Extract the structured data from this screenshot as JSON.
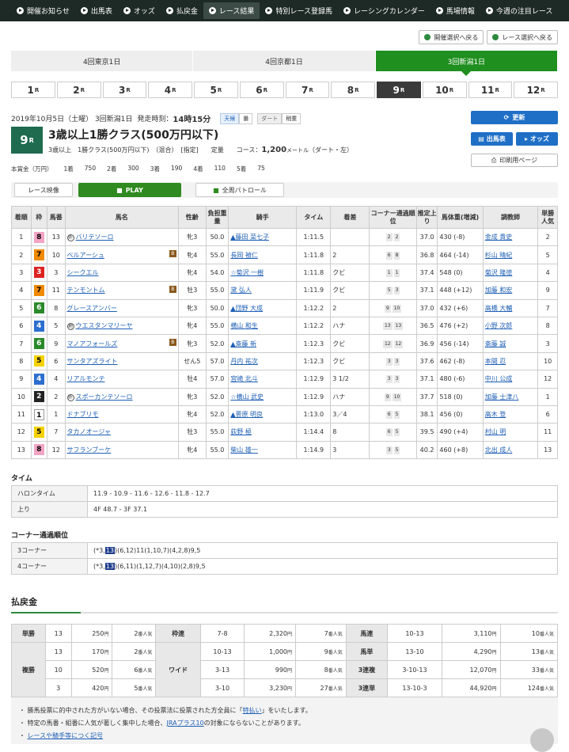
{
  "nav": [
    "開催お知らせ",
    "出馬表",
    "オッズ",
    "払戻金",
    "レース結果",
    "特別レース登録馬",
    "レーシングカレンダー",
    "馬場情報",
    "今週の注目レース"
  ],
  "nav_active": 4,
  "back_buttons": [
    "開催選択へ戻る",
    "レース選択へ戻る"
  ],
  "kaisai_tabs": [
    "4回東京1日",
    "4回京都1日",
    "3回新潟1日"
  ],
  "kaisai_active": 2,
  "race_numbers": [
    "1",
    "2",
    "3",
    "4",
    "5",
    "6",
    "7",
    "8",
    "9",
    "10",
    "11",
    "12"
  ],
  "race_suffix": "R",
  "race_active": 8,
  "info": {
    "date": "2019年10月5日（土曜） 3回新潟1日",
    "start_label": "発走時刻：",
    "start_time": "14時15分",
    "weather_label": "天候",
    "weather": "曇",
    "track_label": "ダート",
    "track_cond": "稍重",
    "race_no": "9",
    "race_r": "R",
    "title": "3歳以上1勝クラス(500万円以下)",
    "sub1": "3歳以上　1勝クラス(500万円以下)　（混合）　[指定]　　定量",
    "course_label": "コース：",
    "distance": "1,200",
    "dist_unit": "メートル",
    "surface": "（ダート・左）"
  },
  "buttons": {
    "refresh": "更新",
    "shutuba": "出馬表",
    "odds": "オッズ",
    "print": "印刷用ページ",
    "video": "レース映像",
    "play": "PLAY",
    "patrol": "全周パトロール"
  },
  "prize": [
    "本賞金（万円）",
    "1着",
    "750",
    "2着",
    "300",
    "3着",
    "190",
    "4着",
    "110",
    "5着",
    "75"
  ],
  "table_headers": [
    "着順",
    "枠",
    "馬番",
    "馬名",
    "性齢",
    "負担重量",
    "騎手",
    "タイム",
    "着差",
    "コーナー通過順位",
    "推定上り",
    "馬体重(増減)",
    "調教師",
    "単勝人気"
  ],
  "results": [
    {
      "pos": "1",
      "waku": "8",
      "num": "13",
      "mark": "外",
      "name": "バリテソーロ",
      "b": "",
      "sex": "牝3",
      "wt": "50.0",
      "jockey": "▲藤田 菜七子",
      "time": "1:11.5",
      "margin": "",
      "c1": "2",
      "c2": "2",
      "agari": "37.0",
      "bw": "430 (-8)",
      "trainer": "金成 貴史",
      "pop": "2"
    },
    {
      "pos": "2",
      "waku": "7",
      "num": "10",
      "mark": "",
      "name": "ベルアーシュ",
      "b": "B",
      "sex": "牝4",
      "wt": "55.0",
      "jockey": "長岡 禎仁",
      "time": "1:11.8",
      "margin": "2",
      "c1": "6",
      "c2": "8",
      "agari": "36.8",
      "bw": "464 (-14)",
      "trainer": "杉山 晴紀",
      "pop": "5"
    },
    {
      "pos": "3",
      "waku": "3",
      "num": "3",
      "mark": "",
      "name": "シークエル",
      "b": "",
      "sex": "牝4",
      "wt": "54.0",
      "jockey": "☆菊沢 一樹",
      "time": "1:11.8",
      "margin": "クビ",
      "c1": "1",
      "c2": "1",
      "agari": "37.4",
      "bw": "548 (0)",
      "trainer": "菊沢 隆徳",
      "pop": "4"
    },
    {
      "pos": "4",
      "waku": "7",
      "num": "11",
      "mark": "",
      "name": "テンモントム",
      "b": "B",
      "sex": "牡3",
      "wt": "55.0",
      "jockey": "黛 弘人",
      "time": "1:11.9",
      "margin": "クビ",
      "c1": "5",
      "c2": "3",
      "agari": "37.1",
      "bw": "448 (+12)",
      "trainer": "加藤 和宏",
      "pop": "9"
    },
    {
      "pos": "5",
      "waku": "6",
      "num": "8",
      "mark": "",
      "name": "グレースアンバー",
      "b": "",
      "sex": "牝3",
      "wt": "50.0",
      "jockey": "▲団野 大成",
      "time": "1:12.2",
      "margin": "2",
      "c1": "9",
      "c2": "10",
      "agari": "37.0",
      "bw": "432 (+6)",
      "trainer": "高橋 大輔",
      "pop": "7"
    },
    {
      "pos": "6",
      "waku": "4",
      "num": "5",
      "mark": "地",
      "name": "ウエスタンマリーヤ",
      "b": "",
      "sex": "牝4",
      "wt": "55.0",
      "jockey": "横山 和生",
      "time": "1:12.2",
      "margin": "ハナ",
      "c1": "13",
      "c2": "13",
      "agari": "36.5",
      "bw": "476 (+2)",
      "trainer": "小野 次郎",
      "pop": "8"
    },
    {
      "pos": "7",
      "waku": "6",
      "num": "9",
      "mark": "",
      "name": "マノアフォールズ",
      "b": "B",
      "sex": "牝3",
      "wt": "52.0",
      "jockey": "▲斎藤 新",
      "time": "1:12.3",
      "margin": "クビ",
      "c1": "12",
      "c2": "12",
      "agari": "36.9",
      "bw": "456 (-14)",
      "trainer": "斎藤 誠",
      "pop": "3"
    },
    {
      "pos": "8",
      "waku": "5",
      "num": "6",
      "mark": "",
      "name": "サンタアズライト",
      "b": "",
      "sex": "せん5",
      "wt": "57.0",
      "jockey": "丹内 祐次",
      "time": "1:12.3",
      "margin": "クビ",
      "c1": "3",
      "c2": "3",
      "agari": "37.6",
      "bw": "462 (-8)",
      "trainer": "本間 忍",
      "pop": "10"
    },
    {
      "pos": "9",
      "waku": "4",
      "num": "4",
      "mark": "",
      "name": "リアルモンテ",
      "b": "",
      "sex": "牡4",
      "wt": "57.0",
      "jockey": "宮崎 北斗",
      "time": "1:12.9",
      "margin": "3 1/2",
      "c1": "3",
      "c2": "3",
      "agari": "37.1",
      "bw": "480 (-6)",
      "trainer": "中川 公成",
      "pop": "12"
    },
    {
      "pos": "10",
      "waku": "2",
      "num": "2",
      "mark": "外",
      "name": "スポーカンテソーロ",
      "b": "",
      "sex": "牝3",
      "wt": "52.0",
      "jockey": "☆横山 武史",
      "time": "1:12.9",
      "margin": "ハナ",
      "c1": "9",
      "c2": "10",
      "agari": "37.7",
      "bw": "518 (0)",
      "trainer": "加藤 士津八",
      "pop": "1"
    },
    {
      "pos": "11",
      "waku": "1",
      "num": "1",
      "mark": "",
      "name": "ドナブリモ",
      "b": "",
      "sex": "牝4",
      "wt": "52.0",
      "jockey": "▲菅原 明良",
      "time": "1:13.0",
      "margin": "3／4",
      "c1": "6",
      "c2": "5",
      "agari": "38.1",
      "bw": "456 (0)",
      "trainer": "高木 登",
      "pop": "6"
    },
    {
      "pos": "12",
      "waku": "5",
      "num": "7",
      "mark": "",
      "name": "タカノオージャ",
      "b": "",
      "sex": "牡3",
      "wt": "55.0",
      "jockey": "荻野 極",
      "time": "1:14.4",
      "margin": "8",
      "c1": "6",
      "c2": "5",
      "agari": "39.5",
      "bw": "490 (+4)",
      "trainer": "村山 明",
      "pop": "11"
    },
    {
      "pos": "13",
      "waku": "8",
      "num": "12",
      "mark": "",
      "name": "サフランブーケ",
      "b": "",
      "sex": "牝4",
      "wt": "55.0",
      "jockey": "柴山 雄一",
      "time": "1:14.9",
      "margin": "3",
      "c1": "3",
      "c2": "5",
      "agari": "40.2",
      "bw": "460 (+8)",
      "trainer": "北出 成人",
      "pop": "13"
    }
  ],
  "time_section": {
    "title": "タイム",
    "rows": [
      [
        "ハロンタイム",
        "11.9 - 10.9 - 11.6 - 12.6 - 11.8 - 12.7"
      ],
      [
        "上り",
        "4F 48.7 - 3F 37.1"
      ]
    ]
  },
  "corner_section": {
    "title": "コーナー通過順位",
    "rows": [
      {
        "label": "3コーナー",
        "pre": "(*3,",
        "hl": "13",
        "post": ")(6,12)11(1,10,7)(4,2,8)9,5"
      },
      {
        "label": "4コーナー",
        "pre": "(*3,",
        "hl": "13",
        "post": ")(6,11)(1,12,7)(4,10)(2,8)9,5"
      }
    ]
  },
  "payout": {
    "title": "払戻金",
    "tansho": {
      "label": "単勝",
      "num": "13",
      "amt": "250",
      "pop": "2"
    },
    "fukusho": {
      "label": "複勝",
      "rows": [
        [
          "13",
          "170",
          "2"
        ],
        [
          "10",
          "520",
          "6"
        ],
        [
          "3",
          "420",
          "5"
        ]
      ]
    },
    "wakuren": {
      "label": "枠連",
      "num": "7-8",
      "amt": "2,320",
      "pop": "7"
    },
    "wide": {
      "label": "ワイド",
      "rows": [
        [
          "10-13",
          "1,000",
          "9"
        ],
        [
          "3-13",
          "990",
          "8"
        ],
        [
          "3-10",
          "3,230",
          "27"
        ]
      ]
    },
    "umaren": {
      "label": "馬連",
      "num": "10-13",
      "amt": "3,110",
      "pop": "10"
    },
    "umatan": {
      "label": "馬単",
      "num": "13-10",
      "amt": "4,290",
      "pop": "13"
    },
    "sanrenpuku": {
      "label": "3連複",
      "num": "3-10-13",
      "amt": "12,070",
      "pop": "33"
    },
    "sanrentan": {
      "label": "3連単",
      "num": "13-10-3",
      "amt": "44,920",
      "pop": "124"
    },
    "yen": "円",
    "pop_suffix": "番人気"
  },
  "notes": [
    {
      "pre": "・ 勝馬投票に的中された方がいない場合、その投票法に投票された方全員に「",
      "link": "特払い",
      "post": "」をいたします。"
    },
    {
      "pre": "・ 特定の馬番・組番に人気が著しく集中した場合、",
      "link": "JRAプラス10",
      "post": "の対象にならないことがあります。"
    },
    {
      "pre": "・ ",
      "link": "レースや騎手等につく記号",
      "post": ""
    }
  ],
  "colors": {
    "nav_bg": "#1e2a25",
    "tab_green": "#1f8f1f",
    "btn_blue": "#1f6fc6",
    "badge": "#1e6b50"
  }
}
